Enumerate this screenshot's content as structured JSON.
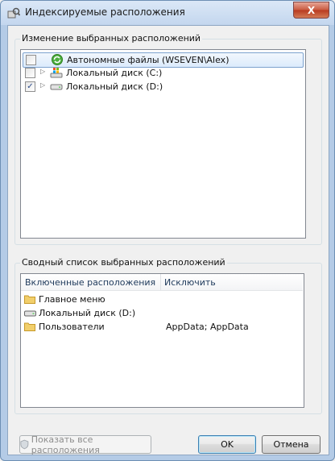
{
  "window": {
    "title": "Индексируемые расположения",
    "close_label": "X"
  },
  "change_group": {
    "label": "Изменение выбранных расположений",
    "items": [
      {
        "label": "Автономные файлы (WSEVEN\\Alex)",
        "checked": false,
        "icon": "sync-center-icon",
        "expandable": false
      },
      {
        "label": "Локальный диск (C:)",
        "checked": false,
        "icon": "windows-drive-icon",
        "expandable": true
      },
      {
        "label": "Локальный диск (D:)",
        "checked": true,
        "icon": "drive-icon",
        "expandable": true
      }
    ]
  },
  "summary_group": {
    "label": "Сводный список выбранных расположений",
    "columns": [
      "Включенные расположения",
      "Исключить"
    ],
    "rows": [
      {
        "location": "Главное меню",
        "exclude": "",
        "icon": "folder-icon"
      },
      {
        "location": "Локальный диск (D:)",
        "exclude": "",
        "icon": "drive-icon"
      },
      {
        "location": "Пользователи",
        "exclude": "AppData; AppData",
        "icon": "folder-icon"
      }
    ]
  },
  "buttons": {
    "show_all": "Показать все расположения",
    "ok": "OK",
    "cancel": "Отмена"
  },
  "checkmark": "✓",
  "expander_glyph": "▷"
}
